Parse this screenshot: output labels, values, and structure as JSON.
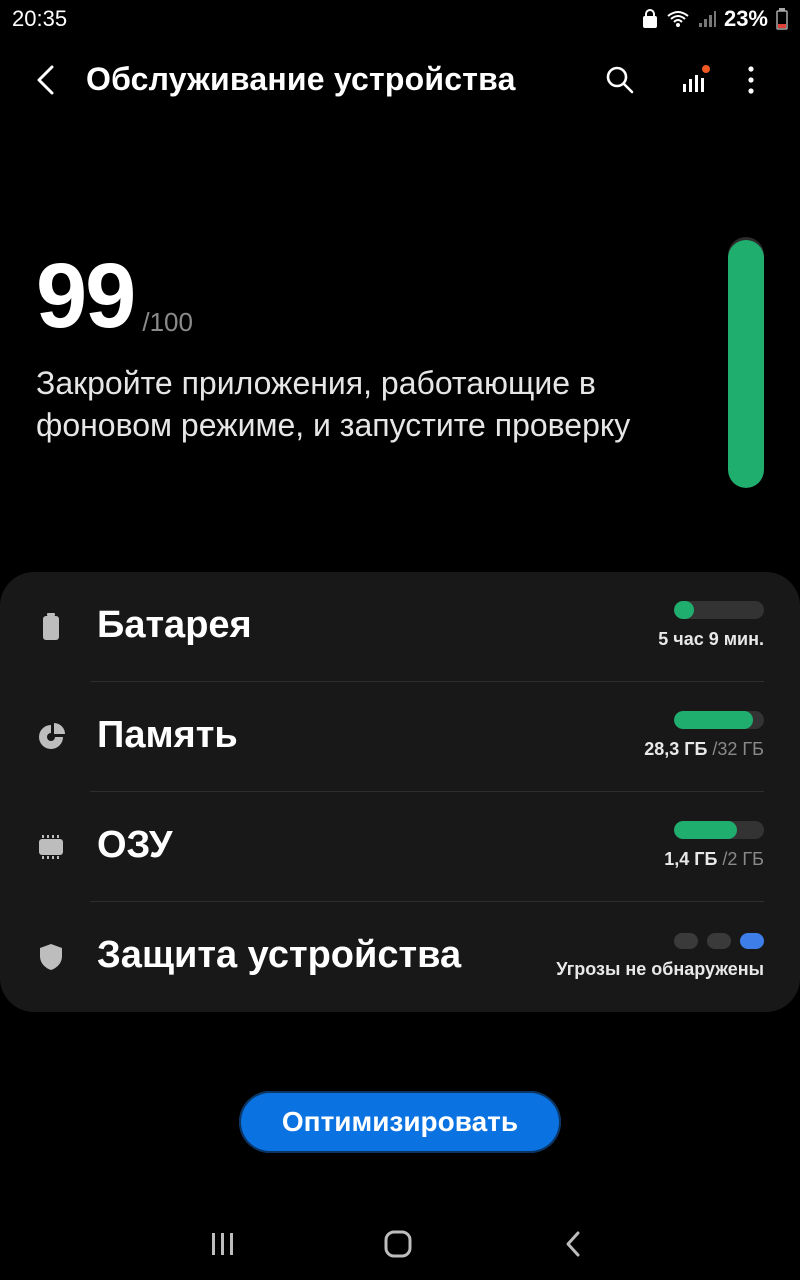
{
  "status_bar": {
    "time": "20:35",
    "battery_percent": "23%"
  },
  "header": {
    "title": "Обслуживание устройства",
    "icons": [
      "back-arrow-icon",
      "search-icon",
      "signal-bars-icon",
      "more-vert-icon"
    ]
  },
  "score": {
    "value": "99",
    "max": "/100",
    "message": "Закройте приложения, работающие в фоновом режиме, и запустите проверку",
    "meter_fraction": 0.99
  },
  "items": [
    {
      "label": "Батарея",
      "icon": "battery-icon",
      "detail": "5 час 9 мин.",
      "bar_fraction": 0.22
    },
    {
      "label": "Память",
      "icon": "storage-pie-icon",
      "detail_value": "28,3 ГБ",
      "detail_total": "/32 ГБ",
      "bar_fraction": 0.88
    },
    {
      "label": "ОЗУ",
      "icon": "memory-chip-icon",
      "detail_value": "1,4 ГБ",
      "detail_total": "/2 ГБ",
      "bar_fraction": 0.7
    },
    {
      "label": "Защита устройства",
      "icon": "shield-icon",
      "detail": "Угрозы не обнаружены"
    }
  ],
  "optimize_button": {
    "label": "Оптимизировать"
  },
  "nav": {
    "icons": [
      "recents-icon",
      "home-icon",
      "back-icon"
    ]
  },
  "colors": {
    "accent_green": "#1fae6e",
    "button_blue": "#0a72e1",
    "protection_dot": "#3d7ee8"
  }
}
